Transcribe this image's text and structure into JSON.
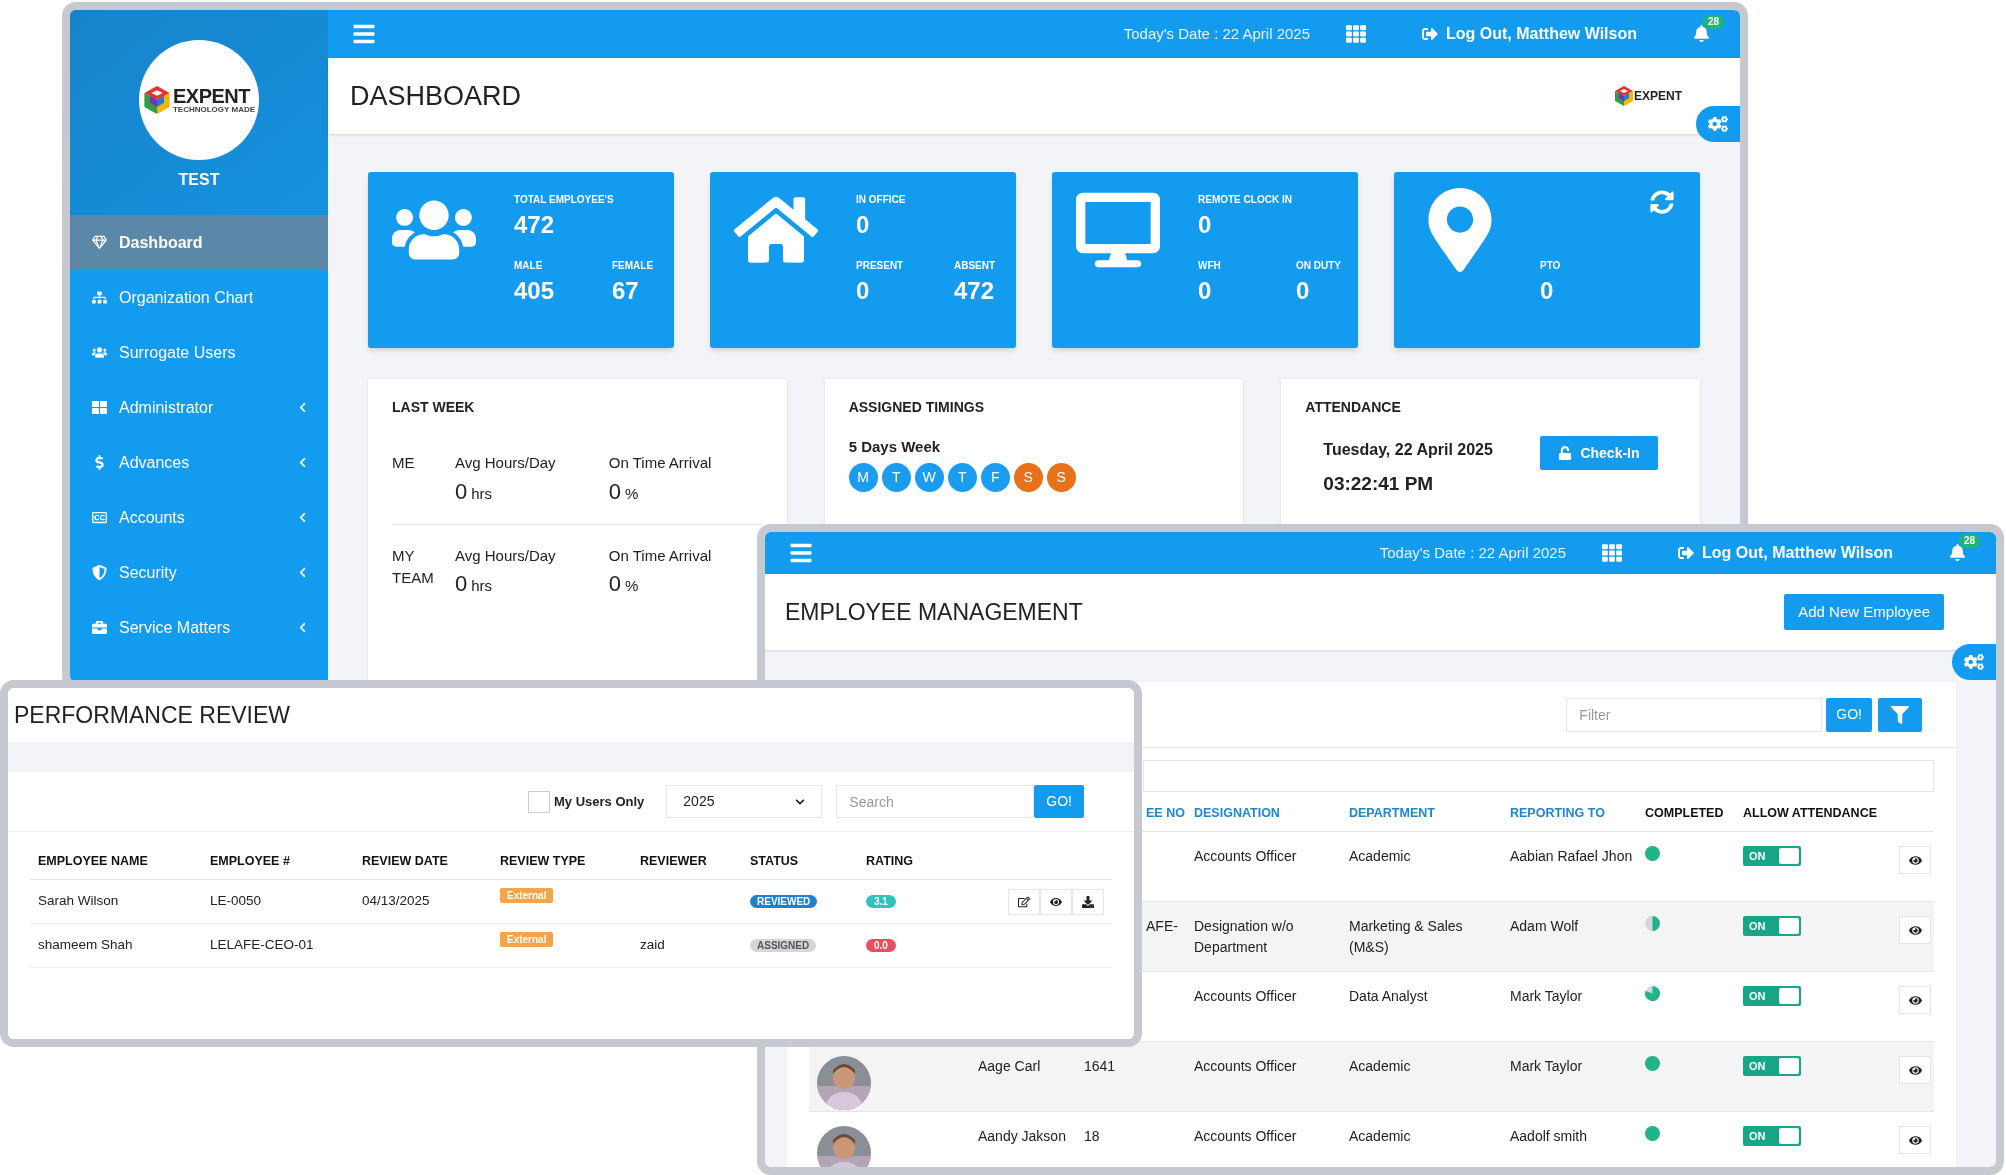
{
  "dashboard_window": {
    "sidebar": {
      "logo": {
        "name": "EXPENT",
        "tagline": "TECHNOLOGY MADE"
      },
      "company": "TEST",
      "items": [
        {
          "label": "Dashboard",
          "kind": "gem",
          "selected": true,
          "submenu": false
        },
        {
          "label": "Organization Chart",
          "kind": "sitemap",
          "selected": false,
          "submenu": false
        },
        {
          "label": "Surrogate Users",
          "kind": "users",
          "selected": false,
          "submenu": false
        },
        {
          "label": "Administrator",
          "kind": "grid",
          "selected": false,
          "submenu": true
        },
        {
          "label": "Advances",
          "kind": "dollar",
          "selected": false,
          "submenu": true
        },
        {
          "label": "Accounts",
          "kind": "cc",
          "selected": false,
          "submenu": true
        },
        {
          "label": "Security",
          "kind": "shield",
          "selected": false,
          "submenu": true
        },
        {
          "label": "Service Matters",
          "kind": "briefcase",
          "selected": false,
          "submenu": true
        }
      ]
    },
    "topbar": {
      "date": "Today's Date : 22 April 2025",
      "user": "Log Out, Matthew Wilson",
      "notifications": "28"
    },
    "title": "DASHBOARD",
    "brand": "EXPENT",
    "stat_cards": [
      {
        "kind": "users",
        "refresh": false,
        "headline": {
          "label": "TOTAL EMPLOYEE'S",
          "value": "472"
        },
        "stats": [
          {
            "label": "MALE",
            "value": "405"
          },
          {
            "label": "FEMALE",
            "value": "67"
          }
        ]
      },
      {
        "kind": "home",
        "refresh": false,
        "headline": {
          "label": "IN OFFICE",
          "value": "0"
        },
        "stats": [
          {
            "label": "PRESENT",
            "value": "0"
          },
          {
            "label": "ABSENT",
            "value": "472"
          }
        ]
      },
      {
        "kind": "desktop",
        "refresh": false,
        "headline": {
          "label": "REMOTE CLOCK IN",
          "value": "0"
        },
        "stats": [
          {
            "label": "WFH",
            "value": "0"
          },
          {
            "label": "ON DUTY",
            "value": "0"
          }
        ]
      },
      {
        "kind": "pin",
        "refresh": true,
        "stats": [
          {
            "label": "PTO",
            "value": "0"
          }
        ]
      }
    ],
    "last_week": {
      "title": "LAST WEEK",
      "rows": [
        {
          "label": "ME",
          "metrics": [
            {
              "label": "Avg Hours/Day",
              "value": "0",
              "unit": "hrs"
            },
            {
              "label": "On Time Arrival",
              "value": "0",
              "unit": "%"
            }
          ]
        },
        {
          "label": "MY TEAM",
          "metrics": [
            {
              "label": "Avg Hours/Day",
              "value": "0",
              "unit": "hrs"
            },
            {
              "label": "On Time Arrival",
              "value": "0",
              "unit": "%"
            }
          ]
        }
      ]
    },
    "assigned_timings": {
      "title": "ASSIGNED TIMINGS",
      "schedule": "5 Days Week",
      "days": [
        {
          "label": "M",
          "color": "#1a9cf0"
        },
        {
          "label": "T",
          "color": "#1a9cf0"
        },
        {
          "label": "W",
          "color": "#1a9cf0"
        },
        {
          "label": "T",
          "color": "#1a9cf0"
        },
        {
          "label": "F",
          "color": "#1a9cf0"
        },
        {
          "label": "S",
          "color": "#e8711c"
        },
        {
          "label": "S",
          "color": "#e8711c"
        }
      ]
    },
    "attendance": {
      "title": "ATTENDANCE",
      "date": "Tuesday, 22 April 2025",
      "time": "03:22:41 PM",
      "button": "Check-In"
    }
  },
  "employee_window": {
    "topbar": {
      "date": "Today's Date : 22 April 2025",
      "user": "Log Out, Matthew Wilson",
      "notifications": "28"
    },
    "title": "EMPLOYEE MANAGEMENT",
    "add_button": "Add New Employee",
    "filter": {
      "placeholder": "Filter",
      "button": "GO!"
    },
    "columns": [
      {
        "label": "EE NO",
        "sortable": true
      },
      {
        "label": "DESIGNATION",
        "sortable": true
      },
      {
        "label": "DEPARTMENT",
        "sortable": true
      },
      {
        "label": "REPORTING TO",
        "sortable": true
      },
      {
        "label": "COMPLETED",
        "sortable": false
      },
      {
        "label": "ALLOW ATTENDANCE",
        "sortable": false
      }
    ],
    "rows": [
      {
        "photo": false,
        "designation": "Accounts Officer",
        "department": "Academic",
        "reporting_to": "Aabian Rafael Jhon",
        "completed": {
          "kind": "full"
        },
        "attendance": {
          "label": "ON",
          "on": true
        }
      },
      {
        "photo": false,
        "employee_no": "AFE-",
        "employee_no_cut": true,
        "designation": "Designation w/o Department",
        "department": "Marketing & Sales (M&S)",
        "reporting_to": "Adam Wolf",
        "completed": {
          "kind": "half"
        },
        "attendance": {
          "label": "ON",
          "on": true
        }
      },
      {
        "photo": false,
        "designation": "Accounts Officer",
        "department": "Data Analyst",
        "reporting_to": "Mark Taylor",
        "completed": {
          "kind": "most"
        },
        "attendance": {
          "label": "ON",
          "on": true
        }
      },
      {
        "photo": true,
        "name": "Aage Carl",
        "employee_no": "1641",
        "employee_no_cut": false,
        "designation": "Accounts Officer",
        "department": "Academic",
        "reporting_to": "Mark Taylor",
        "completed": {
          "kind": "full"
        },
        "attendance": {
          "label": "ON",
          "on": true
        }
      },
      {
        "photo": true,
        "name": "Aandy Jakson",
        "employee_no": "18",
        "employee_no_cut": false,
        "designation": "Accounts Officer",
        "department": "Academic",
        "reporting_to": "Aadolf smith",
        "completed": {
          "kind": "full"
        },
        "attendance": {
          "label": "ON",
          "on": true
        }
      }
    ]
  },
  "performance_window": {
    "title": "PERFORMANCE REVIEW",
    "filters": {
      "my_users_only": {
        "label": "My Users Only",
        "checked": false
      },
      "year": "2025",
      "search_placeholder": "Search",
      "button": "GO!"
    },
    "columns": [
      "EMPLOYEE NAME",
      "EMPLOYEE #",
      "REVIEW DATE",
      "REVIEW TYPE",
      "REVIEWER",
      "STATUS",
      "RATING"
    ],
    "rows": [
      {
        "name": "Sarah Wilson",
        "employee_no": "LE-0050",
        "review_date": "04/13/2025",
        "review_type": "External",
        "status": {
          "label": "REVIEWED",
          "color": "#1f80cc"
        },
        "rating": {
          "label": "3.1",
          "color": "#2fc3bd"
        },
        "actions": true
      },
      {
        "name": "shameem Shah",
        "employee_no": "LELAFE-CEO-01",
        "review_type": "External",
        "reviewer": "zaid",
        "status": {
          "label": "ASSIGNED",
          "color": "#d3d6da"
        },
        "rating": {
          "label": "0.0",
          "color": "#e94f5d"
        },
        "actions": false
      }
    ]
  }
}
